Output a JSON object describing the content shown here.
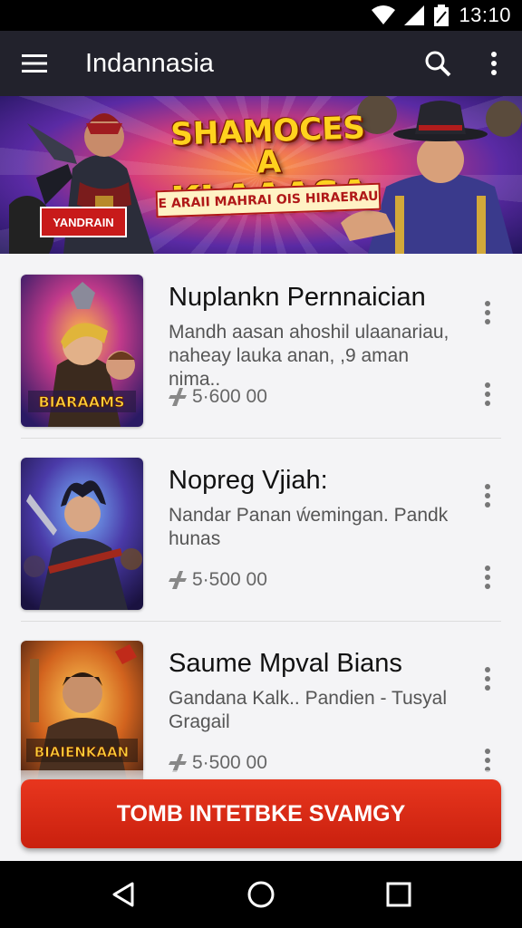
{
  "status_bar": {
    "time": "13:10"
  },
  "app_bar": {
    "title": "Indannasia"
  },
  "banner": {
    "headline_line1": "SHAMOCES A",
    "headline_line2": "KLAAASA",
    "tagline": "E ARAII MAHRAI OIS HIRAERAU",
    "badge": "YANDRAIN"
  },
  "items": [
    {
      "name": "Nuplankn Pernnaician",
      "description": "Mandh aasan ahoshil ulaanariau, naheay lauka anan, ,9 aman nima..",
      "price": "5·600 00",
      "thumb_caption": "BIARAAMS"
    },
    {
      "name": "Nopreg Vjiah:",
      "description": "Nandar Panan ẃemingan. Pandk hunas",
      "price": "5·500 00",
      "thumb_caption": ""
    },
    {
      "name": "Saume Mpval Bians",
      "description": "Gandana Kalk.. Pandien - Tusyal Gragail",
      "price": "5·500 00",
      "thumb_caption": "BIAIENKAAN"
    }
  ],
  "cta": {
    "label": "TOMB INTETBKE SVAMGY"
  },
  "colors": {
    "accent": "#d52a15",
    "app_bar": "#22222c"
  }
}
